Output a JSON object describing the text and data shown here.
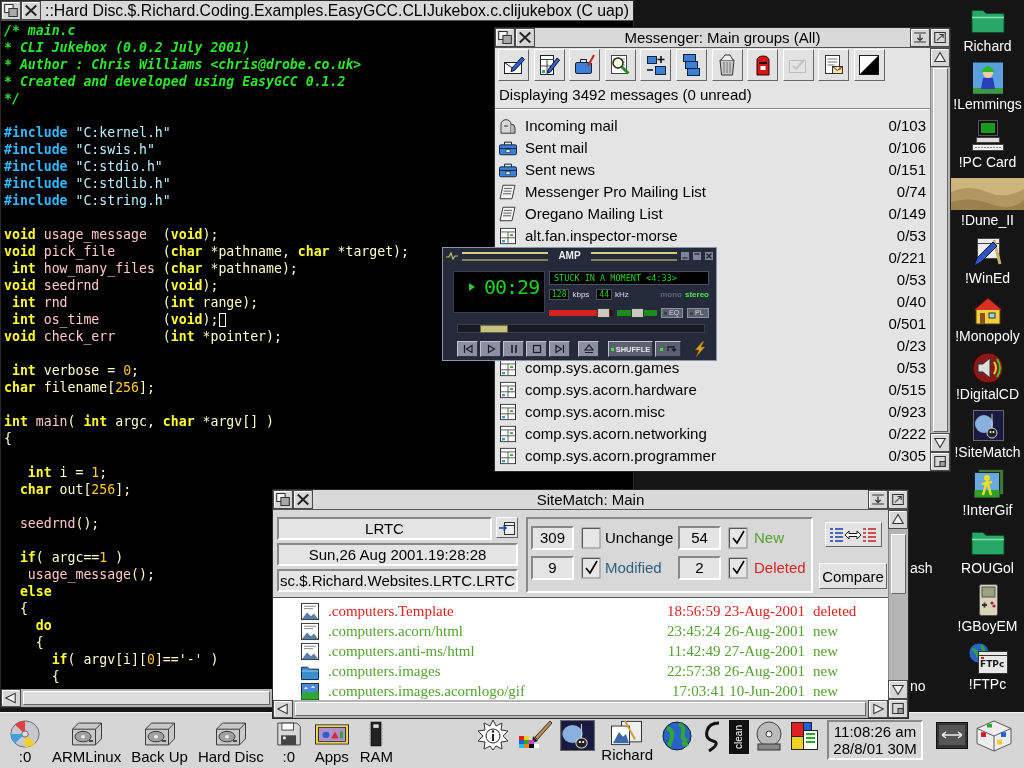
{
  "editor": {
    "title": "::Hard Disc.$.Richard.Coding.Examples.EasyGCC.CLIJukebox.c.clijukebox (C uap)",
    "blocks": [
      {
        "lines": [
          {
            "tokens": [
              {
                "kind": "comment",
                "text": "/* main.c"
              }
            ]
          },
          {
            "tokens": [
              {
                "kind": "comment",
                "text": "* CLI Jukebox (0.0.2 July 2001)"
              }
            ]
          },
          {
            "tokens": [
              {
                "kind": "comment",
                "text": "* Author : Chris Williams <chris@drobe.co.uk>"
              }
            ]
          },
          {
            "tokens": [
              {
                "kind": "comment",
                "text": "* Created and developed using EasyGCC 0.1.2"
              }
            ]
          },
          {
            "tokens": [
              {
                "kind": "comment",
                "text": "*/"
              }
            ]
          }
        ]
      },
      {
        "lines": [
          {
            "tokens": [
              {
                "kind": "directive",
                "text": "#include"
              },
              {
                "kind": "header",
                "text": " \"C:kernel.h\""
              }
            ]
          },
          {
            "tokens": [
              {
                "kind": "directive",
                "text": "#include"
              },
              {
                "kind": "header",
                "text": " \"C:swis.h\""
              }
            ]
          },
          {
            "tokens": [
              {
                "kind": "directive",
                "text": "#include"
              },
              {
                "kind": "header",
                "text": " \"C:stdio.h\""
              }
            ]
          },
          {
            "tokens": [
              {
                "kind": "directive",
                "text": "#include"
              },
              {
                "kind": "header",
                "text": " \"C:stdlib.h\""
              }
            ]
          },
          {
            "tokens": [
              {
                "kind": "directive",
                "text": "#include"
              },
              {
                "kind": "header",
                "text": " \"C:string.h\""
              }
            ]
          }
        ]
      },
      {
        "lines": [
          {
            "tokens": [
              {
                "kind": "keyword",
                "text": "void"
              },
              {
                "kind": "function",
                "text": " usage_message"
              },
              {
                "kind": "text",
                "text": "  ("
              },
              {
                "kind": "keyword",
                "text": "void"
              },
              {
                "kind": "text",
                "text": ");"
              }
            ]
          },
          {
            "tokens": [
              {
                "kind": "keyword",
                "text": "void"
              },
              {
                "kind": "function",
                "text": " pick_file"
              },
              {
                "kind": "text",
                "text": "      ("
              },
              {
                "kind": "keyword",
                "text": "char"
              },
              {
                "kind": "text",
                "text": " *pathname, "
              },
              {
                "kind": "keyword",
                "text": "char"
              },
              {
                "kind": "text",
                "text": " *target);"
              }
            ]
          },
          {
            "tokens": [
              {
                "kind": "keyword",
                "text": " int"
              },
              {
                "kind": "function",
                "text": " how_many_files"
              },
              {
                "kind": "text",
                "text": " ("
              },
              {
                "kind": "keyword",
                "text": "char"
              },
              {
                "kind": "text",
                "text": " *pathname);"
              }
            ]
          },
          {
            "tokens": [
              {
                "kind": "keyword",
                "text": "void"
              },
              {
                "kind": "function",
                "text": " seedrnd"
              },
              {
                "kind": "text",
                "text": "        ("
              },
              {
                "kind": "keyword",
                "text": "void"
              },
              {
                "kind": "text",
                "text": ");"
              }
            ]
          },
          {
            "tokens": [
              {
                "kind": "keyword",
                "text": " int"
              },
              {
                "kind": "function",
                "text": " rnd"
              },
              {
                "kind": "text",
                "text": "            ("
              },
              {
                "kind": "keyword",
                "text": "int"
              },
              {
                "kind": "text",
                "text": " range);"
              }
            ]
          },
          {
            "tokens": [
              {
                "kind": "keyword",
                "text": " int"
              },
              {
                "kind": "function",
                "text": " os_time"
              },
              {
                "kind": "text",
                "text": "        ("
              },
              {
                "kind": "keyword",
                "text": "void"
              },
              {
                "kind": "text",
                "text": ");"
              },
              {
                "kind": "caret"
              }
            ]
          },
          {
            "tokens": [
              {
                "kind": "keyword",
                "text": "void"
              },
              {
                "kind": "function",
                "text": " check_err"
              },
              {
                "kind": "text",
                "text": "      ("
              },
              {
                "kind": "keyword",
                "text": "int"
              },
              {
                "kind": "text",
                "text": " *pointer);"
              }
            ]
          }
        ]
      },
      {
        "lines": [
          {
            "tokens": [
              {
                "kind": "keyword",
                "text": " int"
              },
              {
                "kind": "text",
                "text": " verbose = "
              },
              {
                "kind": "number",
                "text": "0"
              },
              {
                "kind": "text",
                "text": ";"
              }
            ]
          },
          {
            "tokens": [
              {
                "kind": "keyword",
                "text": "char"
              },
              {
                "kind": "text",
                "text": " filename["
              },
              {
                "kind": "number",
                "text": "256"
              },
              {
                "kind": "text",
                "text": "];"
              }
            ]
          }
        ]
      },
      {
        "lines": [
          {
            "tokens": [
              {
                "kind": "keyword",
                "text": "int"
              },
              {
                "kind": "function",
                "text": " main"
              },
              {
                "kind": "text",
                "text": "( "
              },
              {
                "kind": "keyword",
                "text": "int"
              },
              {
                "kind": "text",
                "text": " argc, "
              },
              {
                "kind": "keyword",
                "text": "char"
              },
              {
                "kind": "text",
                "text": " *argv[] )"
              }
            ]
          },
          {
            "tokens": [
              {
                "kind": "text",
                "text": "{"
              }
            ]
          }
        ]
      },
      {
        "lines": [
          {
            "tokens": [
              {
                "kind": "keyword",
                "text": "   int"
              },
              {
                "kind": "text",
                "text": " i = "
              },
              {
                "kind": "number",
                "text": "1"
              },
              {
                "kind": "text",
                "text": ";"
              }
            ]
          },
          {
            "tokens": [
              {
                "kind": "keyword",
                "text": "  char"
              },
              {
                "kind": "text",
                "text": " out["
              },
              {
                "kind": "number",
                "text": "256"
              },
              {
                "kind": "text",
                "text": "];"
              }
            ]
          }
        ]
      },
      {
        "lines": [
          {
            "tokens": [
              {
                "kind": "function",
                "text": "  seedrnd"
              },
              {
                "kind": "text",
                "text": "();"
              }
            ]
          }
        ]
      },
      {
        "lines": [
          {
            "tokens": [
              {
                "kind": "keyword",
                "text": "  if"
              },
              {
                "kind": "text",
                "text": "( argc=="
              },
              {
                "kind": "number",
                "text": "1"
              },
              {
                "kind": "text",
                "text": " )"
              }
            ]
          },
          {
            "tokens": [
              {
                "kind": "function",
                "text": "   usage_message"
              },
              {
                "kind": "text",
                "text": "();"
              }
            ]
          },
          {
            "tokens": [
              {
                "kind": "keyword",
                "text": "  else"
              }
            ]
          },
          {
            "tokens": [
              {
                "kind": "text",
                "text": "  {"
              }
            ]
          },
          {
            "tokens": [
              {
                "kind": "keyword",
                "text": "    do"
              }
            ]
          },
          {
            "tokens": [
              {
                "kind": "text",
                "text": "    {"
              }
            ]
          },
          {
            "tokens": [
              {
                "kind": "keyword",
                "text": "      if"
              },
              {
                "kind": "text",
                "text": "( argv[i]["
              },
              {
                "kind": "number",
                "text": "0"
              },
              {
                "kind": "text",
                "text": "]=='-' )"
              }
            ]
          },
          {
            "tokens": [
              {
                "kind": "text",
                "text": "      {"
              }
            ]
          }
        ]
      }
    ]
  },
  "messenger": {
    "title": "Messenger: Main groups (All)",
    "toolbar": [
      {
        "kind": "compose",
        "disabled": false
      },
      {
        "kind": "editgroup",
        "disabled": false
      },
      {
        "kind": "folderpen",
        "disabled": false
      },
      {
        "kind": "search",
        "disabled": false
      },
      {
        "kind": "addremove",
        "disabled": false
      },
      {
        "kind": "stack",
        "disabled": false
      },
      {
        "kind": "bin",
        "disabled": false
      },
      {
        "kind": "postbox",
        "disabled": false
      },
      {
        "kind": "tick",
        "disabled": true
      },
      {
        "kind": "note",
        "disabled": false
      },
      {
        "kind": "contrast",
        "disabled": false
      }
    ],
    "status": "Displaying 3492 messages (0 unread)",
    "groups": [
      {
        "kind": "inbox",
        "name": "Incoming mail",
        "count": "0/103"
      },
      {
        "kind": "outbox",
        "name": "Sent mail",
        "count": "0/106"
      },
      {
        "kind": "outbox",
        "name": "Sent news",
        "count": "0/151"
      },
      {
        "kind": "list",
        "name": "Messenger Pro Mailing List",
        "count": "0/74"
      },
      {
        "kind": "list",
        "name": "Oregano Mailing List",
        "count": "0/149"
      },
      {
        "kind": "newsgroup",
        "name": "alt.fan.inspector-morse",
        "count": "0/53"
      },
      {
        "count": "0/221"
      },
      {
        "count": "0/53"
      },
      {
        "count": "0/40"
      },
      {
        "count": "0/501"
      },
      {
        "count": "0/23"
      },
      {
        "kind": "newsgroup",
        "name": "comp.sys.acorn.games",
        "count": "0/53"
      },
      {
        "kind": "newsgroup",
        "name": "comp.sys.acorn.hardware",
        "count": "0/515"
      },
      {
        "kind": "newsgroup",
        "name": "comp.sys.acorn.misc",
        "count": "0/923"
      },
      {
        "kind": "newsgroup",
        "name": "comp.sys.acorn.networking",
        "count": "0/222"
      },
      {
        "kind": "newsgroup",
        "name": "comp.sys.acorn.programmer",
        "count": "0/305"
      }
    ]
  },
  "player": {
    "title": "AMP",
    "time": "00:29",
    "track": "STUCK IN A MOMENT <4:33>",
    "bitrate": "128",
    "bitrate_unit": "kbps",
    "samplerate": "44",
    "samplerate_unit": "kHz",
    "modes": [
      {
        "label": "mono",
        "selected": false
      },
      {
        "label": "stereo",
        "selected": true
      }
    ],
    "volume": {
      "level": 0.95
    },
    "balance": {
      "level": 0.5
    },
    "panels": [
      {
        "label": "EQ",
        "on": false
      },
      {
        "label": "PL",
        "on": false
      }
    ],
    "seek": {
      "level": 0.1
    },
    "controls": [
      {
        "kind": "previous"
      },
      {
        "kind": "play"
      },
      {
        "kind": "pause"
      },
      {
        "kind": "stop"
      },
      {
        "kind": "next"
      },
      {
        "kind": "eject"
      },
      {
        "kind": "shuffle",
        "label": "SHUFFLE",
        "on": true
      },
      {
        "kind": "repeat",
        "on": true
      }
    ]
  },
  "sitematch": {
    "title": "SiteMatch: Main",
    "site": "LRTC",
    "date": "Sun,26 Aug 2001.19:28:28",
    "path": "sc.$.Richard.Websites.LRTC.LRTC",
    "filters": [
      {
        "count": "309",
        "checked": false,
        "label": "Unchange",
        "color": "#000000"
      },
      {
        "count": "54",
        "checked": true,
        "label": "New",
        "color": "#55a032"
      },
      {
        "count": "9",
        "checked": true,
        "label": "Modified",
        "color": "#2f5f7f"
      },
      {
        "count": "2",
        "checked": true,
        "label": "Deleted",
        "color": "#dd2222"
      }
    ],
    "compare": "Compare",
    "files": [
      {
        "kind": "document",
        "name": ".computers.Template",
        "modified": "18:56:59 23-Aug-2001",
        "status": "deleted",
        "color": "#dd2222"
      },
      {
        "kind": "document",
        "name": ".computers.acorn/html",
        "modified": "23:45:24 26-Aug-2001",
        "status": "new",
        "color": "#55a032"
      },
      {
        "kind": "document",
        "name": ".computers.anti-ms/html",
        "modified": "11:42:49 27-Aug-2001",
        "status": "new",
        "color": "#55a032"
      },
      {
        "kind": "folder",
        "name": ".computers.images",
        "modified": "22:57:38 26-Aug-2001",
        "status": "new",
        "color": "#55a032"
      },
      {
        "kind": "image",
        "name": ".computers.images.acornlogo/gif",
        "modified": "17:03:41 10-Jun-2001",
        "status": "new",
        "color": "#55a032"
      }
    ]
  },
  "pinboard": [
    {
      "kind": "folder",
      "label": "Richard"
    },
    {
      "kind": "lemmings",
      "label": "!Lemmings"
    },
    {
      "kind": "pccard",
      "label": "!PC Card"
    },
    {
      "kind": "dune",
      "label": "!Dune_II"
    },
    {
      "kind": "wined",
      "label": "!WinEd"
    },
    {
      "kind": "monopoly",
      "label": "!Monopoly"
    },
    {
      "kind": "digitalcd",
      "label": "!DigitalCD"
    },
    {
      "kind": "sitematch",
      "label": "!SiteMatch"
    },
    {
      "kind": "intergif",
      "label": "!InterGif"
    },
    {
      "kind": "folder",
      "label": "ROUGol"
    },
    {
      "kind": "gameboy",
      "label": "!GBoyEM"
    },
    {
      "kind": "ftpc",
      "label": "!FTPc",
      "badge": "FTPc"
    }
  ],
  "pinboard_fragments": [
    {
      "label": "ash"
    },
    {
      "label": "no"
    }
  ],
  "iconbar": {
    "devices": [
      {
        "kind": "cd",
        "label": ":0"
      },
      {
        "kind": "harddisc",
        "label": "ARMLinux"
      },
      {
        "kind": "harddisc",
        "label": "Back Up"
      },
      {
        "kind": "harddisc",
        "label": "Hard Disc"
      },
      {
        "kind": "floppy",
        "label": ":0"
      },
      {
        "kind": "apps",
        "label": "Apps"
      },
      {
        "kind": "ram",
        "label": "RAM"
      }
    ],
    "tasks": [
      {
        "kind": "info"
      },
      {
        "kind": "paint"
      },
      {
        "kind": "planet"
      },
      {
        "kind": "document",
        "label": "Richard"
      },
      {
        "kind": "globe"
      },
      {
        "kind": "squiggle"
      },
      {
        "kind": "tile",
        "text": "clean"
      },
      {
        "kind": "disc"
      },
      {
        "kind": "blocks"
      }
    ],
    "clock": {
      "time": "11:08:26 am",
      "date": "28/8/01 30M"
    },
    "system": [
      {
        "kind": "display"
      },
      {
        "kind": "cube"
      }
    ]
  }
}
